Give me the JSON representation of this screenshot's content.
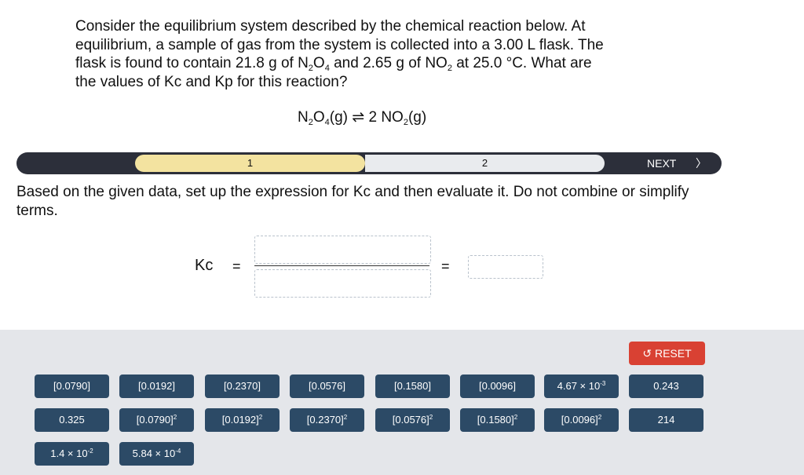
{
  "question": {
    "line1": "Consider the equilibrium system described by the chemical reaction below. At",
    "line2": "equilibrium, a sample of gas from the system is collected into a 3.00 L flask. The",
    "line3_a": "flask is found to contain 21.8 g of N",
    "line3_b": "O",
    "line3_c": " and 2.65 g of NO",
    "line3_d": " at  25.0 °C. What are",
    "line4": "the values of Kc and Kp for this reaction?",
    "sub2": "2",
    "sub4": "4"
  },
  "reaction": {
    "r_n": "N",
    "r_o": "O",
    "r_sub2": "2",
    "r_sub4": "4",
    "r_state": "(g)",
    "arrow": "⇌",
    "coef": " 2 NO",
    "p_sub2": "2",
    "p_state": "(g)"
  },
  "progress": {
    "step1": "1",
    "step2": "2",
    "next": "NEXT",
    "next_chevron": "〉"
  },
  "prompt": "Based on the given data, set up the expression for Kc and then evaluate it. Do not combine or simplify terms.",
  "expression": {
    "label": "Kc",
    "equals1": "=",
    "equals2": "="
  },
  "reset_label": "RESET",
  "reset_icon": "↺",
  "tiles": [
    {
      "base": "[0.0790]",
      "sup": ""
    },
    {
      "base": "[0.0192]",
      "sup": ""
    },
    {
      "base": "[0.2370]",
      "sup": ""
    },
    {
      "base": "[0.0576]",
      "sup": ""
    },
    {
      "base": "[0.1580]",
      "sup": ""
    },
    {
      "base": "[0.0096]",
      "sup": ""
    },
    {
      "base": "4.67 × 10",
      "sup": "-3"
    },
    {
      "base": "0.243",
      "sup": ""
    },
    {
      "base": "0.325",
      "sup": ""
    },
    {
      "base": "[0.0790]",
      "sup": "2"
    },
    {
      "base": "[0.0192]",
      "sup": "2"
    },
    {
      "base": "[0.2370]",
      "sup": "2"
    },
    {
      "base": "[0.0576]",
      "sup": "2"
    },
    {
      "base": "[0.1580]",
      "sup": "2"
    },
    {
      "base": "[0.0096]",
      "sup": "2"
    },
    {
      "base": "214",
      "sup": ""
    },
    {
      "base": "1.4 × 10",
      "sup": "-2"
    },
    {
      "base": "5.84 × 10",
      "sup": "-4"
    }
  ]
}
